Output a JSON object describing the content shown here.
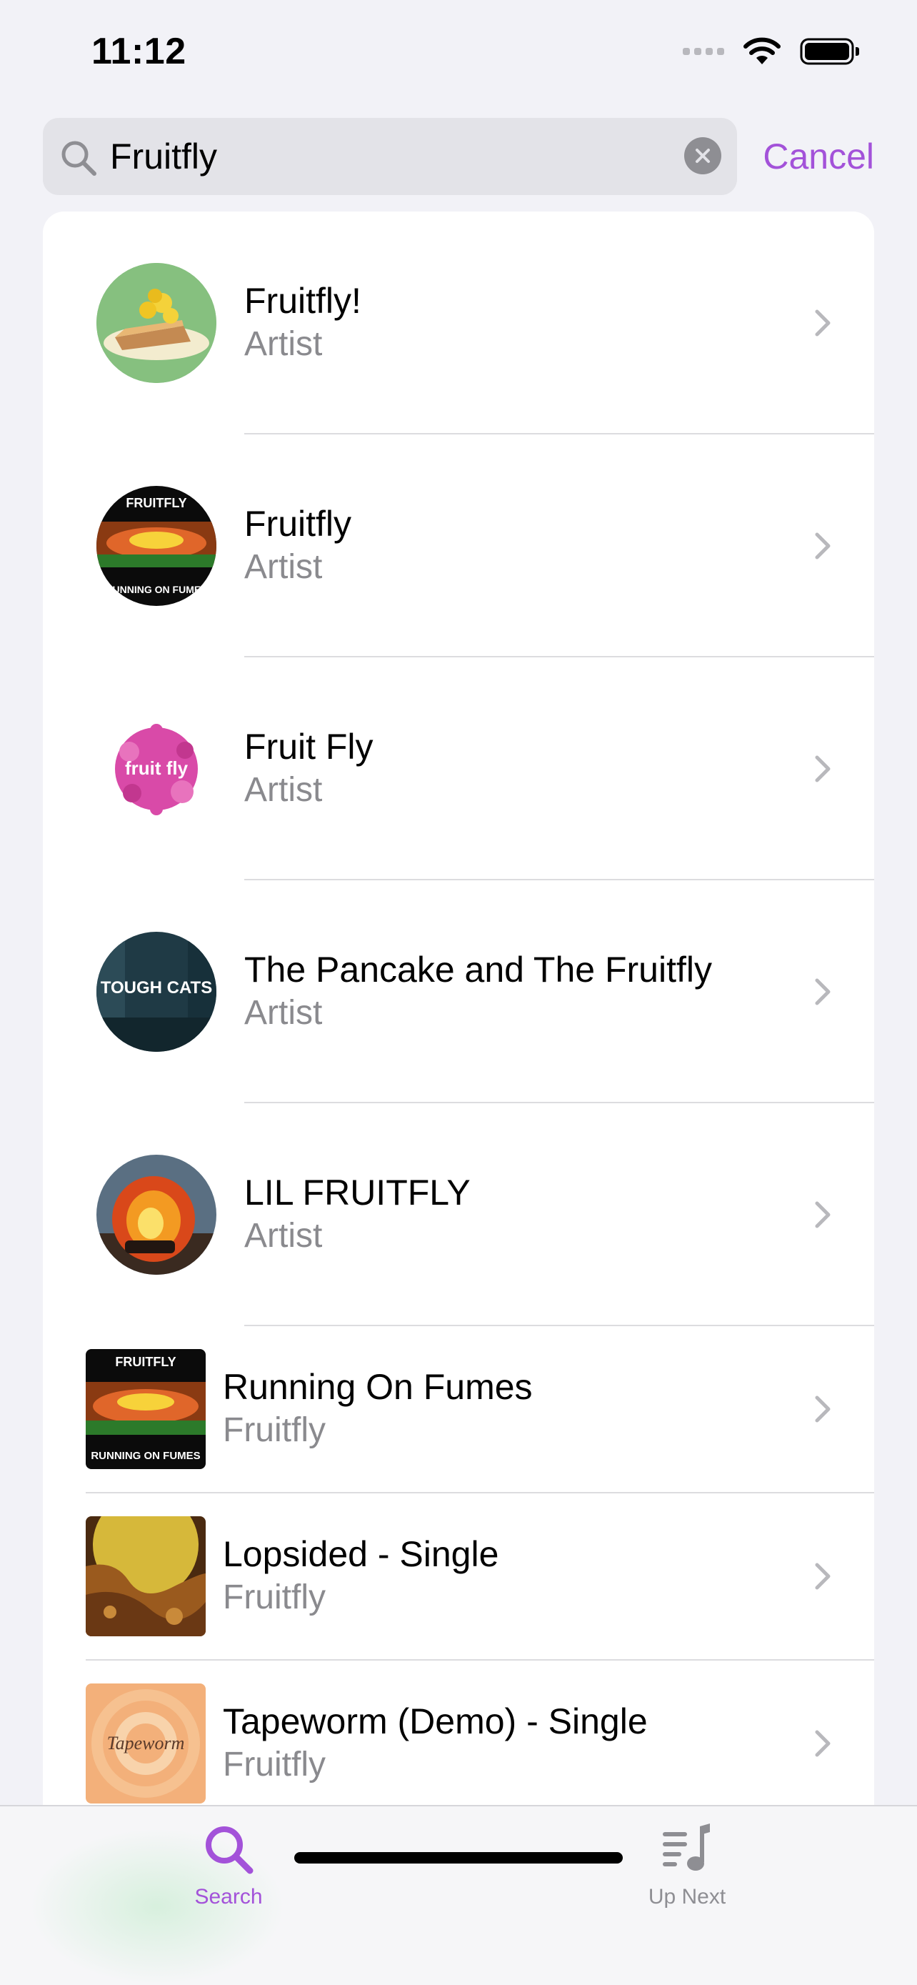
{
  "status_bar": {
    "time": "11:12",
    "icons": [
      "cellular-signal-icon",
      "wifi-icon",
      "battery-icon"
    ]
  },
  "search": {
    "query": "Fruitfly",
    "cancel_label": "Cancel",
    "icon": "magnifying-glass-icon",
    "clear_icon": "clear-x-icon"
  },
  "results": [
    {
      "kind": "artist",
      "title": "Fruitfly!",
      "subtitle": "Artist"
    },
    {
      "kind": "artist",
      "title": "Fruitfly",
      "subtitle": "Artist",
      "art_text_top": "FRUITFLY",
      "art_text_bottom": "RUNNING ON FUMES"
    },
    {
      "kind": "artist",
      "title": "Fruit Fly",
      "subtitle": "Artist",
      "art_text": "fruit fly"
    },
    {
      "kind": "artist",
      "title": "The Pancake and The Fruitfly",
      "subtitle": "Artist",
      "art_text": "TOUGH CATS"
    },
    {
      "kind": "artist",
      "title": "LIL FRUITFLY",
      "subtitle": "Artist"
    },
    {
      "kind": "album",
      "title": "Running On Fumes",
      "subtitle": "Fruitfly",
      "art_text_top": "FRUITFLY",
      "art_text_bottom": "RUNNING ON FUMES"
    },
    {
      "kind": "album",
      "title": "Lopsided - Single",
      "subtitle": "Fruitfly"
    },
    {
      "kind": "album",
      "title": "Tapeworm (Demo) - Single",
      "subtitle": "Fruitfly",
      "art_text": "Tapeworm"
    }
  ],
  "tabs": [
    {
      "label": "Search",
      "icon": "search-icon",
      "selected": true
    },
    {
      "label": "Up Next",
      "icon": "up-next-queue-icon",
      "selected": false
    }
  ],
  "colors": {
    "accent": "#a352d9",
    "background": "#f2f2f7",
    "secondary_text": "#8a8a8e",
    "separator": "#dcdcdf"
  }
}
